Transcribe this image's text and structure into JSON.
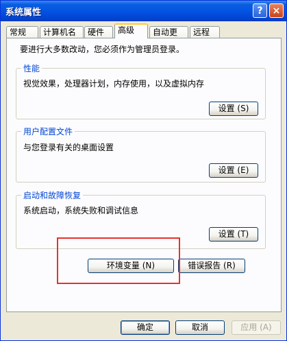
{
  "window": {
    "title": "系统属性",
    "help_symbol": "?",
    "close_symbol": "×"
  },
  "tabs": [
    {
      "label": "常规"
    },
    {
      "label": "计算机名"
    },
    {
      "label": "硬件"
    },
    {
      "label": "高级"
    },
    {
      "label": "自动更新"
    },
    {
      "label": "远程"
    }
  ],
  "active_tab": "高级",
  "intro_text": "要进行大多数改动，您必须作为管理员登录。",
  "groups": {
    "performance": {
      "title": "性能",
      "description": "视觉效果，处理器计划，内存使用，以及虚拟内存",
      "button": "设置 (S)"
    },
    "user_profiles": {
      "title": "用户配置文件",
      "description": "与您登录有关的桌面设置",
      "button": "设置 (E)"
    },
    "startup_recovery": {
      "title": "启动和故障恢复",
      "description": "系统启动，系统失败和调试信息",
      "button": "设置 (T)"
    }
  },
  "actions": {
    "env_vars": "环境变量 (N)",
    "error_report": "错误报告 (R)"
  },
  "footer": {
    "ok": "确定",
    "cancel": "取消",
    "apply": "应用 (A)"
  },
  "colors": {
    "title_bar": "#0554e3",
    "group_label": "#0046d5",
    "highlight": "#e5322b"
  }
}
